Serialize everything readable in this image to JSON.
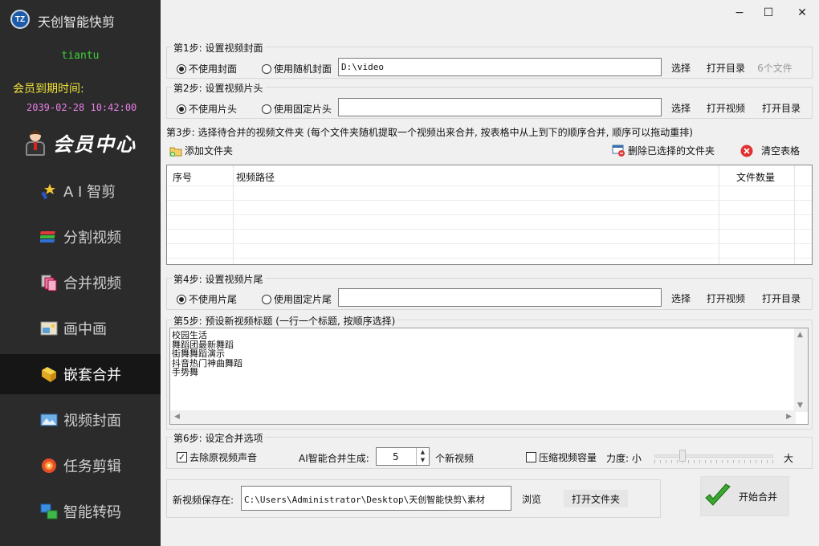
{
  "sidebar": {
    "app_title": "天创智能快剪",
    "logo_text": "TZ",
    "user_name": "tiantu",
    "vip_expire_label": "会员到期时间:",
    "vip_expire_date": "2039-02-28 10:42:00",
    "vip_center": "会员中心",
    "items": [
      {
        "label": "A I 智剪",
        "icon": "ai-wand-icon"
      },
      {
        "label": "分割视频",
        "icon": "split-video-icon"
      },
      {
        "label": "合并视频",
        "icon": "merge-video-icon"
      },
      {
        "label": "画中画",
        "icon": "picture-in-picture-icon"
      },
      {
        "label": "嵌套合并",
        "icon": "nested-merge-icon",
        "active": true
      },
      {
        "label": "视频封面",
        "icon": "video-cover-icon"
      },
      {
        "label": "任务剪辑",
        "icon": "task-edit-icon"
      },
      {
        "label": "智能转码",
        "icon": "transcode-icon"
      }
    ]
  },
  "window": {
    "minimize": "−",
    "maximize": "☐",
    "close": "✕"
  },
  "step1": {
    "title": "第1步: 设置视频封面",
    "opt_none": "不使用封面",
    "opt_random": "使用随机封面",
    "selected": "不使用封面",
    "path": "D:\\video",
    "select_btn": "选择",
    "open_dir_btn": "打开目录",
    "file_count": "6个文件"
  },
  "step2": {
    "title": "第2步: 设置视频片头",
    "opt_none": "不使用片头",
    "opt_fixed": "使用固定片头",
    "selected": "不使用片头",
    "path": "",
    "select_btn": "选择",
    "open_video_btn": "打开视频",
    "open_dir_btn": "打开目录"
  },
  "step3": {
    "title": "第3步: 选择待合并的视频文件夹 (每个文件夹随机提取一个视频出来合并, 按表格中从上到下的顺序合并, 顺序可以拖动重排)",
    "add_folder": "添加文件夹",
    "remove_selected": "删除已选择的文件夹",
    "clear_table": "清空表格",
    "columns": [
      "序号",
      "视频路径",
      "文件数量"
    ],
    "rows": []
  },
  "step4": {
    "title": "第4步: 设置视频片尾",
    "opt_none": "不使用片尾",
    "opt_fixed": "使用固定片尾",
    "selected": "不使用片尾",
    "path": "",
    "select_btn": "选择",
    "open_video_btn": "打开视频",
    "open_dir_btn": "打开目录"
  },
  "step5": {
    "title": "第5步: 预设新视频标题 (一行一个标题, 按顺序选择)",
    "titles": [
      "校园生活",
      "舞蹈团最新舞蹈",
      "街舞舞蹈演示",
      "抖音热门神曲舞蹈",
      "手势舞"
    ]
  },
  "step6": {
    "title": "第6步: 设定合并选项",
    "remove_audio_label": "去除原视频声音",
    "remove_audio_checked": true,
    "ai_count_label": "AI智能合并生成:",
    "ai_count_value": "5",
    "ai_count_unit": "个新视频",
    "compress_label": "压缩视频容量",
    "compress_checked": false,
    "strength_label": "力度: 小",
    "strength_max": "大",
    "strength_level": 0.22
  },
  "output": {
    "label": "新视频保存在:",
    "path": "C:\\Users\\Administrator\\Desktop\\天创智能快剪\\素材",
    "browse_btn": "浏览",
    "open_folder_btn": "打开文件夹"
  },
  "start_button": "开始合并"
}
